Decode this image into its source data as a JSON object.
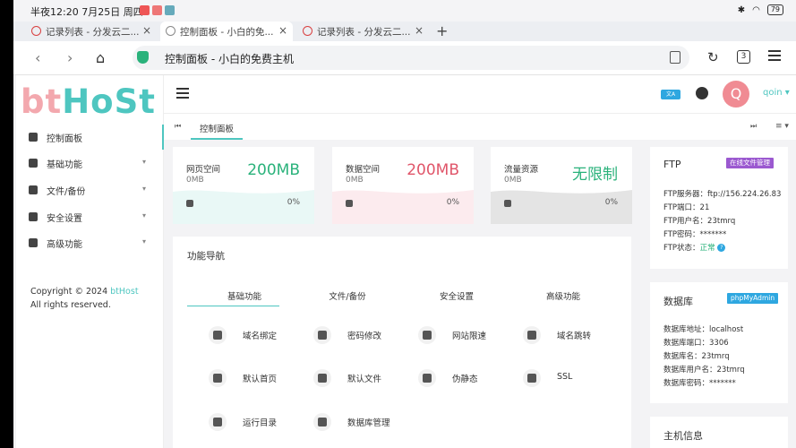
{
  "status_bar": {
    "time": "半夜12:20 7月25日 周四",
    "battery": "79"
  },
  "browser": {
    "tabs": [
      {
        "title": "记录列表 - 分发云二...",
        "active": false
      },
      {
        "title": "控制面板 - 小白的免...",
        "active": true
      },
      {
        "title": "记录列表 - 分发云二...",
        "active": false
      }
    ],
    "address": "控制面板 - 小白的免费主机",
    "tab_count": "3"
  },
  "sidebar": {
    "logo_part1": "bt",
    "logo_part2": "HoSt",
    "items": [
      {
        "label": "控制面板"
      },
      {
        "label": "基础功能"
      },
      {
        "label": "文件/备份"
      },
      {
        "label": "安全设置"
      },
      {
        "label": "高级功能"
      }
    ],
    "copyright_prefix": "Copyright © 2024 ",
    "copyright_brand": "btHost",
    "copyright_suffix": " All rights reserved."
  },
  "header": {
    "avatar_letter": "Q",
    "username": "qoin ▾"
  },
  "page_tabs": {
    "first": "⏮",
    "current": "控制面板",
    "last": "⏭",
    "menu": "≡ ▾"
  },
  "stats": [
    {
      "label": "网页空间",
      "small": "0MB",
      "value": "200MB",
      "percent": "0%",
      "color": "#2ab27b"
    },
    {
      "label": "数据空间",
      "small": "0MB",
      "value": "200MB",
      "percent": "0%",
      "color": "#e0566a"
    },
    {
      "label": "流量资源",
      "small": "0MB",
      "value": "无限制",
      "percent": "0%",
      "color": "#2ab27b"
    }
  ],
  "ftp": {
    "title": "FTP",
    "badge": "在线文件管理",
    "server": "FTP服务器：ftp://156.224.26.83",
    "port": "FTP端口：21",
    "user": "FTP用户名：23tmrq",
    "password": "FTP密码：*******",
    "status_label": "FTP状态：",
    "status_value": "正常",
    "status_help": "?"
  },
  "database": {
    "title": "数据库",
    "badge": "phpMyAdmin",
    "host": "数据库地址：localhost",
    "port": "数据库端口：3306",
    "name": "数据库名：23tmrq",
    "user": "数据库用户名：23tmrq",
    "password": "数据库密码：*******"
  },
  "host_info": {
    "title": "主机信息"
  },
  "function_nav": {
    "title": "功能导航",
    "tabs": [
      "基础功能",
      "文件/备份",
      "安全设置",
      "高级功能"
    ],
    "items": [
      {
        "label": "域名绑定",
        "icon": "globe-icon"
      },
      {
        "label": "密码修改",
        "icon": "key-icon"
      },
      {
        "label": "网站限速",
        "icon": "rocket-icon"
      },
      {
        "label": "域名跳转",
        "icon": "redirect-icon"
      },
      {
        "label": "默认首页",
        "icon": "umbrella-icon"
      },
      {
        "label": "默认文件",
        "icon": "home-icon"
      },
      {
        "label": "伪静态",
        "icon": "puzzle-icon"
      },
      {
        "label": "SSL",
        "icon": "ssl-icon"
      },
      {
        "label": "运行目录",
        "icon": "folder-icon"
      },
      {
        "label": "数据库管理",
        "icon": "database-icon"
      }
    ]
  }
}
